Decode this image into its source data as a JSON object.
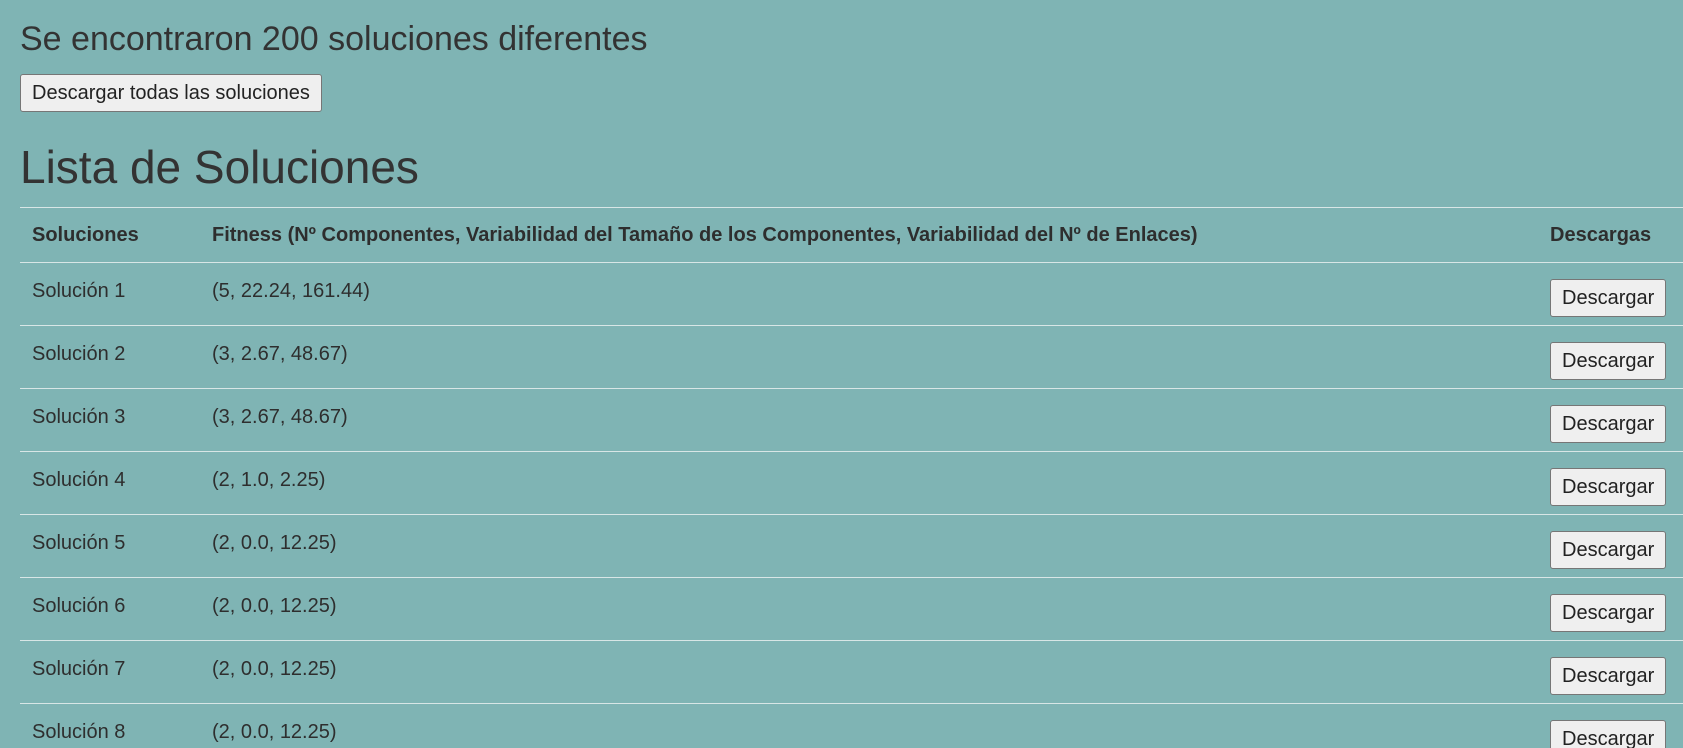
{
  "summary": {
    "found_text": "Se encontraron 200 soluciones diferentes",
    "download_all_label": "Descargar todas las soluciones"
  },
  "list": {
    "title": "Lista de Soluciones",
    "headers": {
      "solutions": "Soluciones",
      "fitness": "Fitness (Nº Componentes, Variabilidad del Tamaño de los Componentes, Variabilidad del Nº de Enlaces)",
      "downloads": "Descargas"
    },
    "download_label": "Descargar",
    "rows": [
      {
        "name": "Solución 1",
        "fitness": "(5, 22.24, 161.44)"
      },
      {
        "name": "Solución 2",
        "fitness": "(3, 2.67, 48.67)"
      },
      {
        "name": "Solución 3",
        "fitness": "(3, 2.67, 48.67)"
      },
      {
        "name": "Solución 4",
        "fitness": "(2, 1.0, 2.25)"
      },
      {
        "name": "Solución 5",
        "fitness": "(2, 0.0, 12.25)"
      },
      {
        "name": "Solución 6",
        "fitness": "(2, 0.0, 12.25)"
      },
      {
        "name": "Solución 7",
        "fitness": "(2, 0.0, 12.25)"
      },
      {
        "name": "Solución 8",
        "fitness": "(2, 0.0, 12.25)"
      }
    ]
  }
}
